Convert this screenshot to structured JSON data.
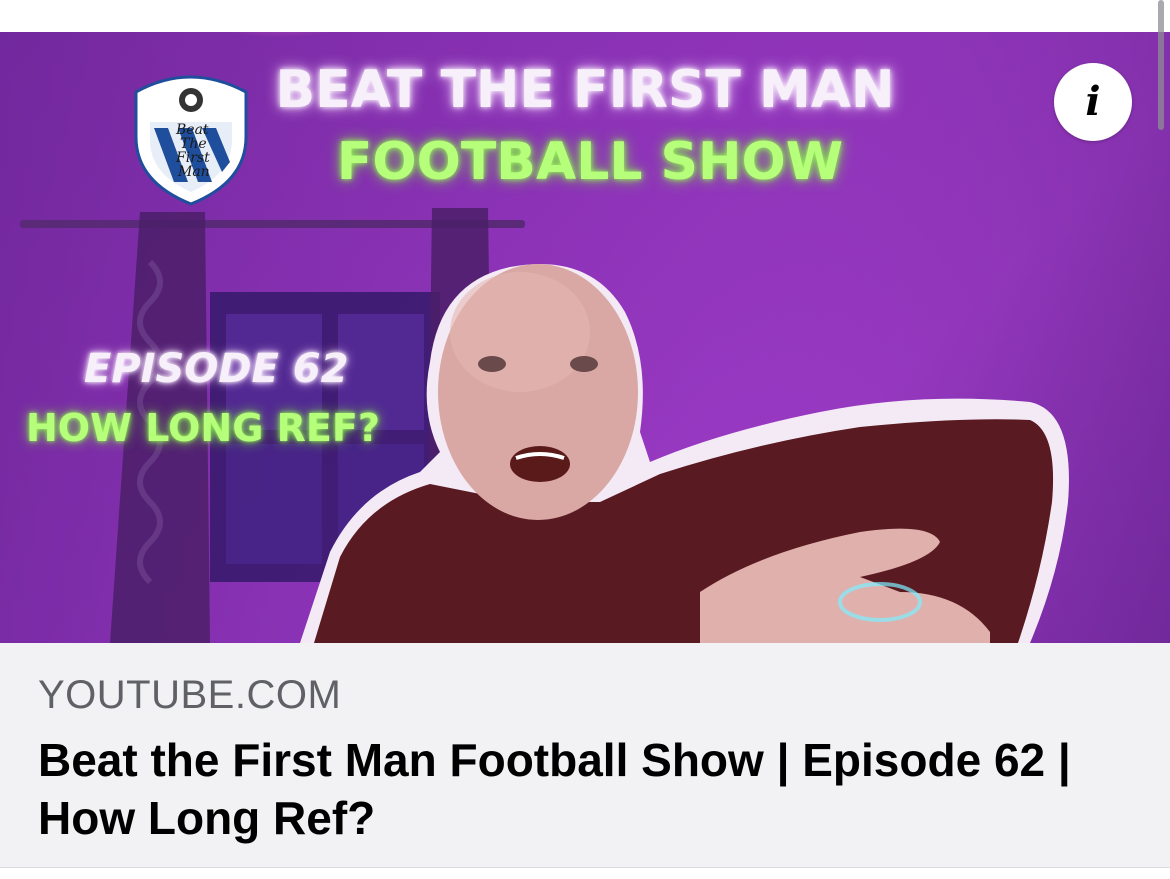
{
  "thumbnail": {
    "overlay_title_line1": "BEAT THE FIRST MAN",
    "overlay_title_line2": "FOOTBALL SHOW",
    "overlay_episode": "EPISODE 62",
    "overlay_question": "HOW LONG REF?",
    "badge": {
      "line1": "Beat",
      "line2": "The",
      "line3": "First",
      "line4": "Man"
    },
    "info_icon": "info-icon",
    "colors": {
      "background": "#8d33b8",
      "title_white": "#f7f0fb",
      "title_green": "#b6ff7a"
    }
  },
  "link_preview": {
    "domain": "YOUTUBE.COM",
    "title": "Beat the First Man Football Show | Episode 62 | How Long Ref?"
  }
}
